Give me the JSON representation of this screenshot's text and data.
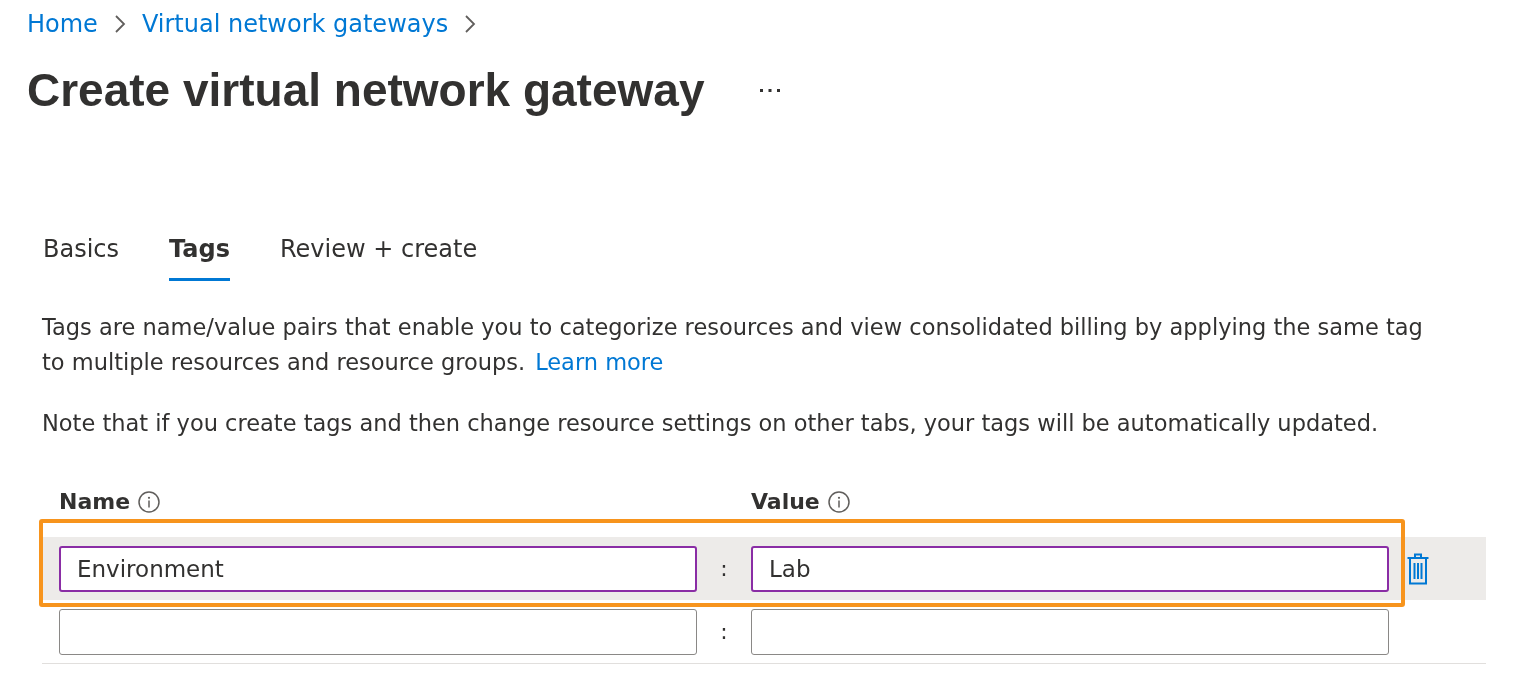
{
  "breadcrumb": [
    {
      "label": "Home"
    },
    {
      "label": "Virtual network gateways"
    }
  ],
  "page_title": "Create virtual network gateway",
  "tabs": [
    {
      "label": "Basics",
      "selected": false
    },
    {
      "label": "Tags",
      "selected": true
    },
    {
      "label": "Review + create",
      "selected": false
    }
  ],
  "description": {
    "text": "Tags are name/value pairs that enable you to categorize resources and view consolidated billing by applying the same tag to multiple resources and resource groups.",
    "link": "Learn more"
  },
  "note": "Note that if you create tags and then change resource settings on other tabs, your tags will be automatically updated.",
  "tag_table": {
    "columns": [
      {
        "label": "Name"
      },
      {
        "label": "Value"
      }
    ],
    "rows": [
      {
        "name": "Environment",
        "separator": ":",
        "value": "Lab",
        "selected": true,
        "highlighted": true
      },
      {
        "separator": ":",
        "selected": false,
        "highlighted": false
      }
    ]
  }
}
